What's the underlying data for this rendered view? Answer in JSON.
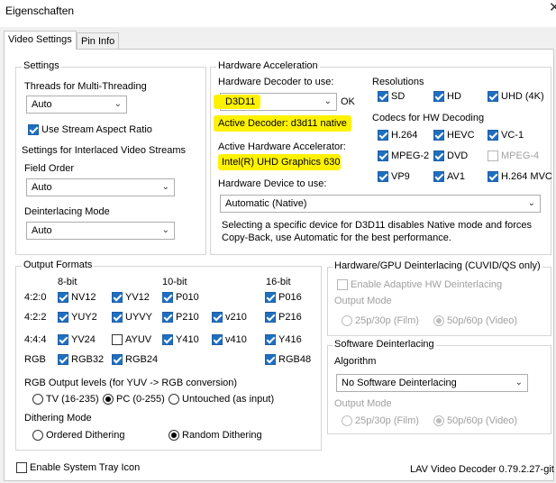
{
  "window": {
    "title": "Eigenschaften",
    "close": "✕"
  },
  "tabs": [
    "Video Settings",
    "Pin Info"
  ],
  "settings": {
    "title": "Settings",
    "threads_label": "Threads for Multi-Threading",
    "threads_value": "Auto",
    "stream_aspect": "Use Stream Aspect Ratio",
    "interlaced_title": "Settings for Interlaced Video Streams",
    "field_order_label": "Field Order",
    "field_order_value": "Auto",
    "deint_mode_label": "Deinterlacing Mode",
    "deint_mode_value": "Auto"
  },
  "hwaccel": {
    "title": "Hardware Acceleration",
    "decoder_label": "Hardware Decoder to use:",
    "decoder_value": "D3D11",
    "ok": "OK",
    "active_decoder": "Active Decoder:  d3d11 native",
    "active_accel_label": "Active Hardware Accelerator:",
    "active_accel_value": "Intel(R) UHD Graphics 630",
    "device_label": "Hardware Device to use:",
    "device_value": "Automatic (Native)",
    "note1": "Selecting a specific device for D3D11 disables Native mode and forces",
    "note2": "Copy-Back, use Automatic for the best performance.",
    "resolutions_title": "Resolutions",
    "res_sd": "SD",
    "res_hd": "HD",
    "res_uhd": "UHD (4K)",
    "codecs_title": "Codecs for HW Decoding",
    "c_h264": "H.264",
    "c_hevc": "HEVC",
    "c_vc1": "VC-1",
    "c_mpeg2": "MPEG-2",
    "c_dvd": "DVD",
    "c_mpeg4": "MPEG-4",
    "c_vp9": "VP9",
    "c_av1": "AV1",
    "c_h264mvc": "H.264 MVC"
  },
  "output": {
    "title": "Output Formats",
    "h8": "8-bit",
    "h10": "10-bit",
    "h16": "16-bit",
    "r420": "4:2:0",
    "r422": "4:2:2",
    "r444": "4:4:4",
    "rrgb": "RGB",
    "nv12": "NV12",
    "yv12": "YV12",
    "p010": "P010",
    "p016": "P016",
    "yuy2": "YUY2",
    "uyvy": "UYVY",
    "p210": "P210",
    "v210": "v210",
    "p216": "P216",
    "yv24": "YV24",
    "ayuv": "AYUV",
    "y410": "Y410",
    "v410": "v410",
    "y416": "Y416",
    "rgb32": "RGB32",
    "rgb24": "RGB24",
    "rgb48": "RGB48",
    "levels_label": "RGB Output levels (for YUV -> RGB conversion)",
    "lvl_tv": "TV (16-235)",
    "lvl_pc": "PC (0-255)",
    "lvl_untouched": "Untouched (as input)",
    "dither_label": "Dithering Mode",
    "dither_ordered": "Ordered Dithering",
    "dither_random": "Random Dithering"
  },
  "hwdeint": {
    "title": "Hardware/GPU Deinterlacing (CUVID/QS only)",
    "adaptive": "Enable Adaptive HW Deinterlacing",
    "output_mode": "Output Mode",
    "film": "25p/30p (Film)",
    "video": "50p/60p (Video)"
  },
  "swdeint": {
    "title": "Software Deinterlacing",
    "algorithm_label": "Algorithm",
    "algorithm_value": "No Software Deinterlacing",
    "output_mode": "Output Mode",
    "film": "25p/30p (Film)",
    "video": "50p/60p (Video)"
  },
  "footer": {
    "tray": "Enable System Tray Icon",
    "version": "LAV Video Decoder 0.79.2.27-git"
  }
}
